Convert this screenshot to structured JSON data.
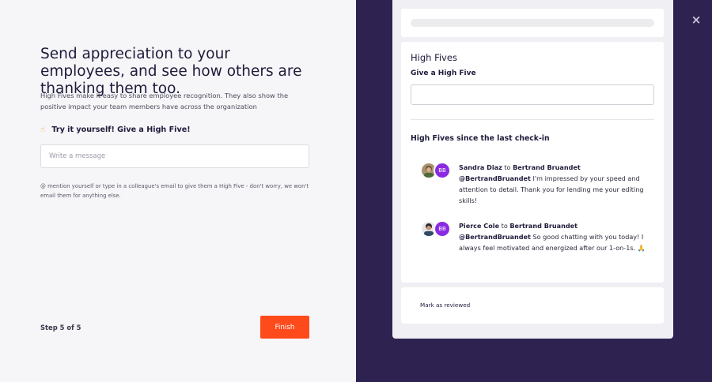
{
  "left": {
    "headline": "Send appreciation to your employees, and see how others are thanking them too.",
    "description": "High Fives make it easy to share employee recognition. They also show the positive impact your team members have across the organization",
    "try_label": "Try it yourself! Give a High Five!",
    "message_placeholder": "Write a message",
    "hint": "@ mention yourself or type in a colleague's email to give them a High Five - don't worry, we won't email them for anything else.",
    "step": "Step 5 of 5",
    "finish_label": "Finish"
  },
  "right": {
    "close_icon": "×",
    "card_title": "High Fives",
    "give_label": "Give a High Five",
    "since_title": "High Fives since the last check-in",
    "entries": [
      {
        "sender": "Sandra Diaz",
        "to": "to",
        "recipient": "Bertrand Bruandet",
        "mention": "@BertrandBruandet",
        "message": " I'm impressed by your speed and attention to detail. Thank you for lending me your editing skills!",
        "badge": "BB"
      },
      {
        "sender": "Pierce Cole",
        "to": "to",
        "recipient": "Bertrand Bruandet",
        "mention": "@BertrandBruandet",
        "message": " So good chatting with you today! I always feel motivated and energized after our 1-on-1s. 🙏",
        "badge": "BB"
      }
    ],
    "mark_reviewed": "Mark as reviewed"
  },
  "colors": {
    "accent": "#ff4a1c",
    "panel_dark": "#2e2350",
    "badge": "#8a2be2"
  }
}
